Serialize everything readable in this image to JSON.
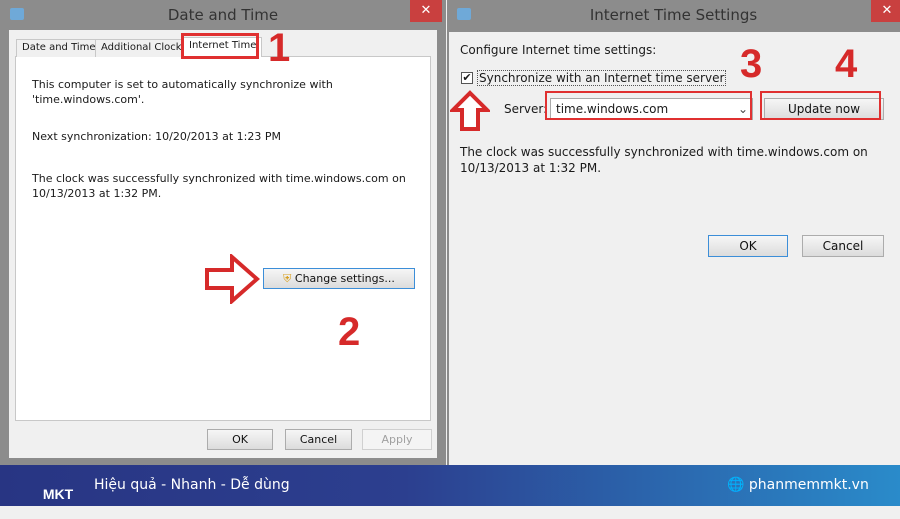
{
  "left_window": {
    "title": "Date and Time",
    "close": "✕",
    "tabs": [
      {
        "label": "Date and Time"
      },
      {
        "label": "Additional Clocks"
      },
      {
        "label": "Internet Time"
      }
    ],
    "text1": "This computer is set to automatically synchronize with",
    "text1b": "'time.windows.com'.",
    "next_sync": "Next synchronization: 10/20/2013 at 1:23 PM",
    "status1": "The clock was successfully synchronized with time.windows.com on",
    "status1b": "10/13/2013 at 1:32 PM.",
    "change_settings": "Change settings...",
    "ok": "OK",
    "cancel": "Cancel",
    "apply": "Apply"
  },
  "right_window": {
    "title": "Internet Time Settings",
    "close": "✕",
    "configure": "Configure Internet time settings:",
    "sync_label": "Synchronize with an Internet time server",
    "sync_checked": true,
    "server_label": "Server:",
    "server_value": "time.windows.com",
    "update_now": "Update now",
    "status1": "The clock was successfully synchronized with time.windows.com on",
    "status1b": "10/13/2013 at 1:32 PM.",
    "ok": "OK",
    "cancel": "Cancel"
  },
  "annotations": {
    "step1": "1",
    "step2": "2",
    "step3": "3",
    "step4": "4",
    "color": "#d62a2a"
  },
  "footer": {
    "logo": "MKT",
    "slogan": "Hiệu quả - Nhanh - Dễ dùng",
    "website": "phanmemmkt.vn"
  }
}
